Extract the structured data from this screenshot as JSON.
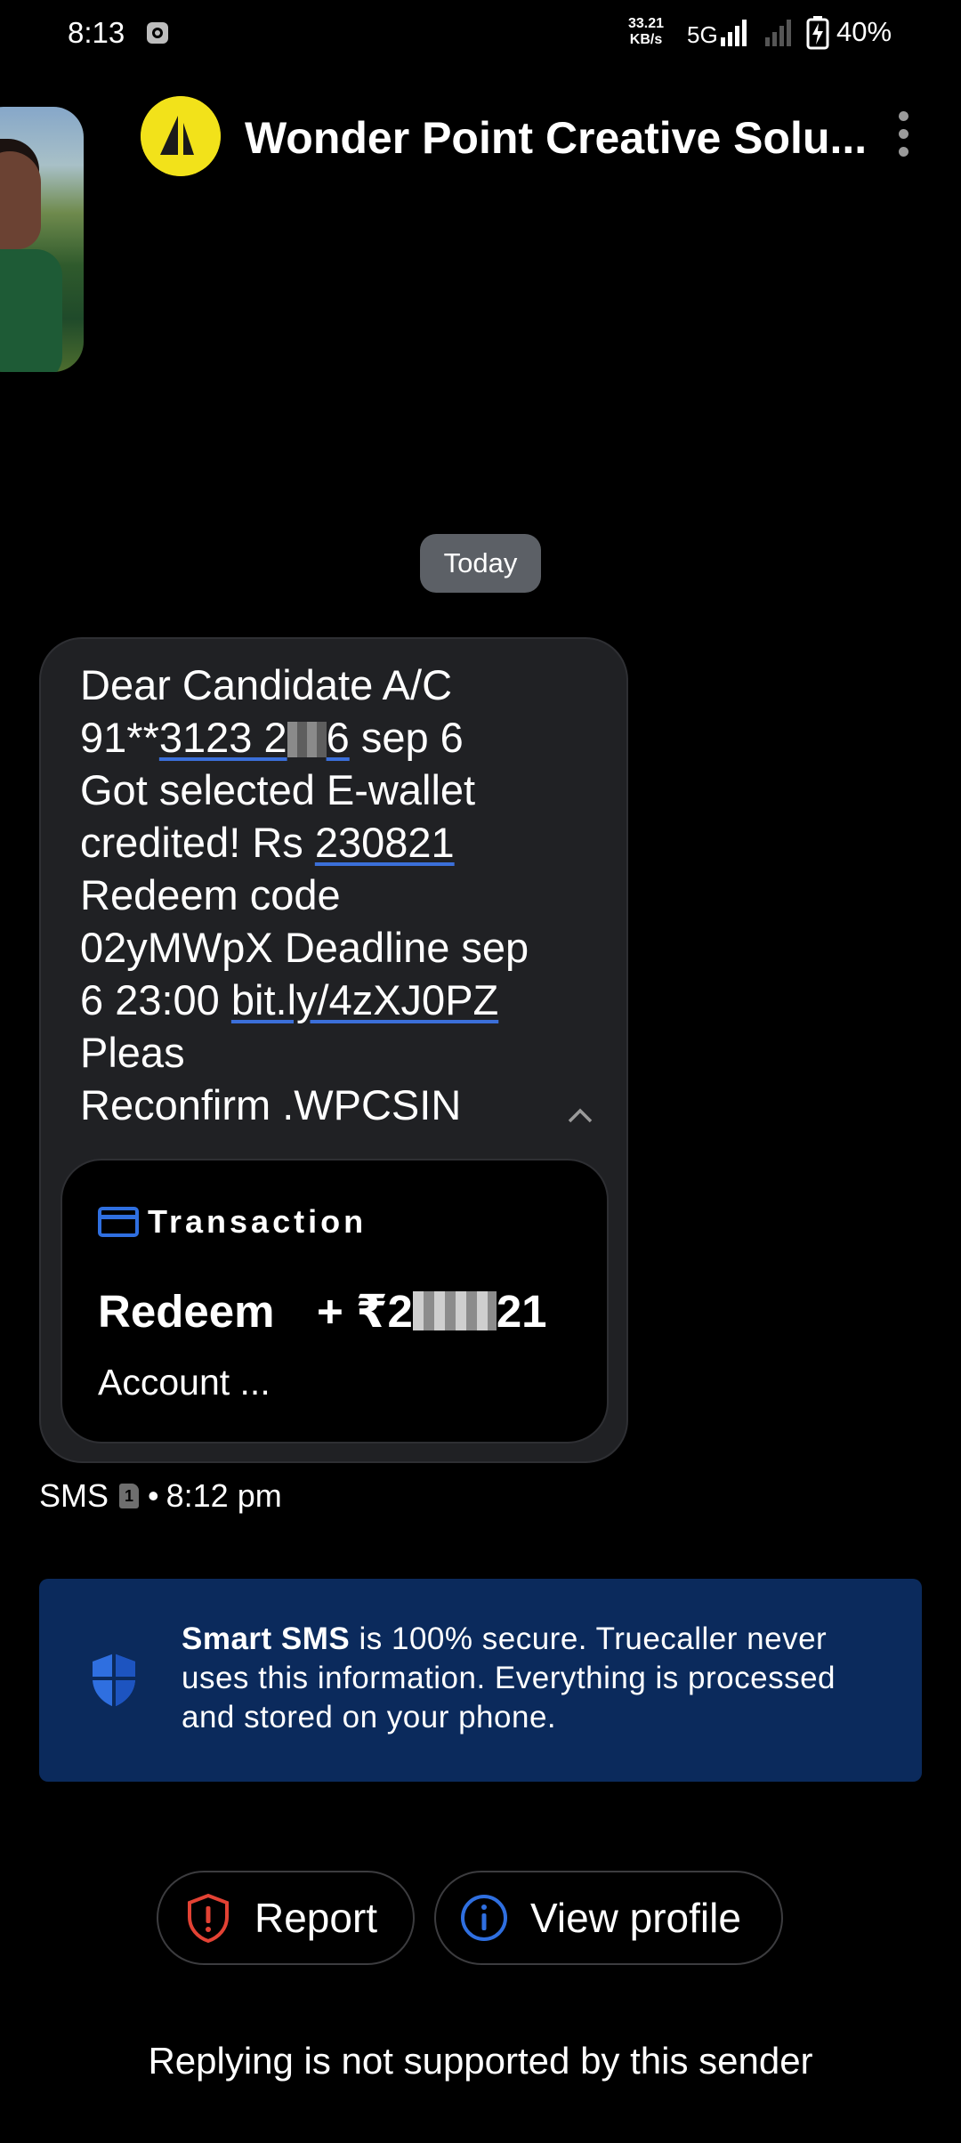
{
  "status_bar": {
    "time": "8:13",
    "speed_value": "33.21",
    "speed_unit": "KB/s",
    "network": "5G",
    "battery": "40%"
  },
  "header": {
    "sender": "Wonder Point Creative Solu...",
    "avatar_color": "#f2e21a"
  },
  "conversation": {
    "date_chip": "Today",
    "message": {
      "l1": "Dear Candidate A/C",
      "l2a": "91**",
      "l2b": "3123 2",
      "l2c": "6",
      "l2d": " sep 6",
      "l3": "Got selected E-wallet",
      "l4a": "credited! Rs ",
      "l4b": "230821",
      "l5": "Redeem code",
      "l6": "02yMWpX Deadline sep",
      "l7a": "6 23:00 ",
      "l7b": "bit.ly/4zXJ0PZ",
      "l8": "Pleas",
      "l9": "Reconfirm .WPCSIN"
    },
    "transaction": {
      "title": "Transaction",
      "label": "Redeem",
      "amount_prefix": "+ ₹2",
      "amount_suffix": "21",
      "account": "Account ..."
    },
    "meta": {
      "type": "SMS",
      "sim": "1",
      "separator": "•",
      "time": "8:12 pm"
    }
  },
  "banner": {
    "strong": "Smart SMS",
    "text": " is 100% secure. Truecaller never uses this information. Everything is processed and stored on your phone."
  },
  "actions": {
    "report": "Report",
    "view_profile": "View profile"
  },
  "footer": {
    "note": "Replying is not supported by this sender"
  },
  "colors": {
    "accent_blue": "#2f6fe0",
    "report_red": "#e34234",
    "banner_bg": "#0b2a5c"
  }
}
